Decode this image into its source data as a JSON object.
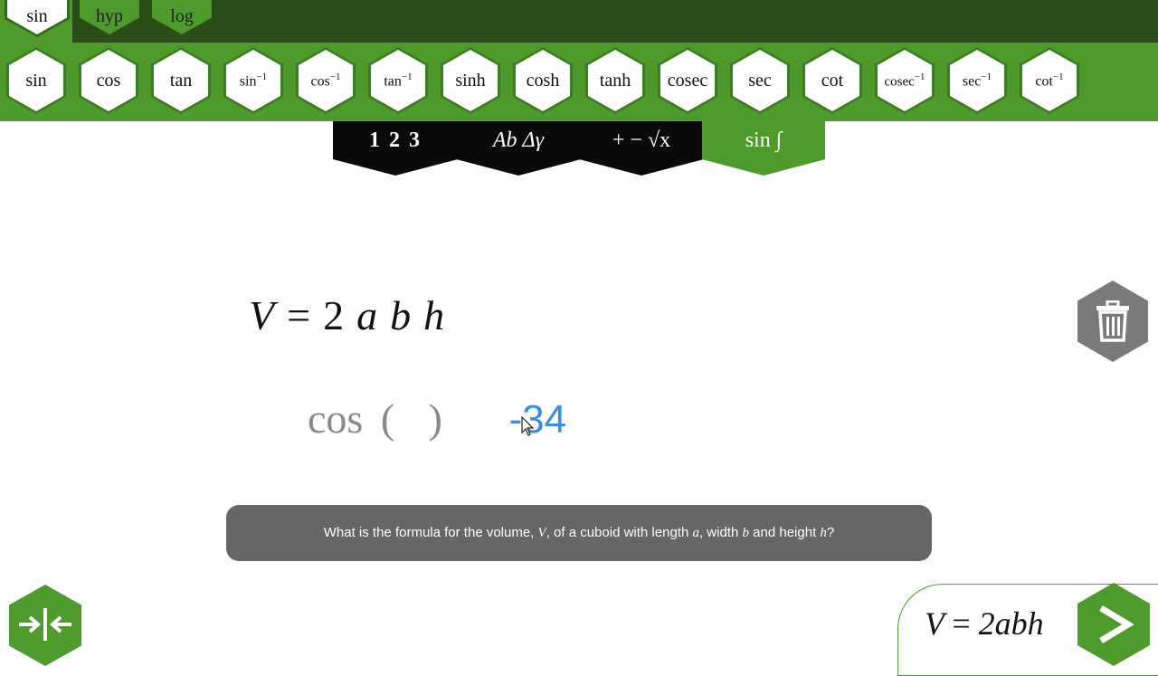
{
  "tabs": [
    {
      "label": "sin",
      "active": true
    },
    {
      "label": "hyp",
      "active": false
    },
    {
      "label": "log",
      "active": false
    }
  ],
  "functions": [
    {
      "label": "sin",
      "sup": ""
    },
    {
      "label": "cos",
      "sup": ""
    },
    {
      "label": "tan",
      "sup": ""
    },
    {
      "label": "sin",
      "sup": "−1"
    },
    {
      "label": "cos",
      "sup": "−1"
    },
    {
      "label": "tan",
      "sup": "−1"
    },
    {
      "label": "sinh",
      "sup": ""
    },
    {
      "label": "cosh",
      "sup": ""
    },
    {
      "label": "tanh",
      "sup": ""
    },
    {
      "label": "cosec",
      "sup": ""
    },
    {
      "label": "sec",
      "sup": ""
    },
    {
      "label": "cot",
      "sup": ""
    },
    {
      "label": "cosec",
      "sup": "−1"
    },
    {
      "label": "sec",
      "sup": "−1"
    },
    {
      "label": "cot",
      "sup": "−1"
    }
  ],
  "keyboard_modes": [
    {
      "label": "1 2 3",
      "active": false
    },
    {
      "label": "Ab Δγ",
      "active": false
    },
    {
      "label": "+ − √x",
      "active": false
    },
    {
      "label": "sin ∫",
      "active": true
    }
  ],
  "equation": {
    "lhs": "V",
    "eq": "=",
    "coef": "2",
    "vars": [
      "a",
      "b",
      "h"
    ]
  },
  "pieces": {
    "function": "cos",
    "open_paren": "(",
    "close_paren": ")",
    "number": "-34"
  },
  "question": {
    "part1": "What is the formula for the volume, ",
    "var_v": "V",
    "part2": ", of a cuboid with length ",
    "var_a": "a",
    "part3": ", width ",
    "var_b": "b",
    "part4": " and height ",
    "var_h": "h",
    "part5": "?"
  },
  "answer": {
    "lhs": "V",
    "eq": "=",
    "rhs": "2abh"
  },
  "icons": {
    "trash": "trash-icon",
    "collapse": "collapse-arrows-icon",
    "next": "chevron-right-icon"
  },
  "colors": {
    "brand_green": "#4e9a2c",
    "dark_green": "#2a4d1a",
    "number_blue": "#3b8de0",
    "question_bg": "#666666"
  }
}
